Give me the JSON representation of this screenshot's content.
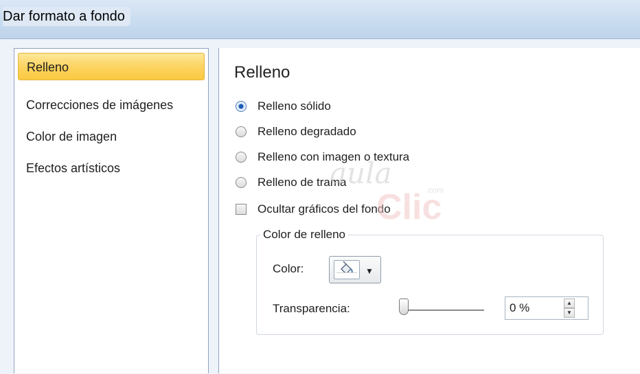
{
  "window": {
    "title": "Dar formato a fondo"
  },
  "sidebar": {
    "items": [
      {
        "label": "Relleno",
        "selected": true
      },
      {
        "label": "Correcciones de imágenes",
        "selected": false
      },
      {
        "label": "Color de imagen",
        "selected": false
      },
      {
        "label": "Efectos artísticos",
        "selected": false
      }
    ]
  },
  "main": {
    "heading": "Relleno",
    "fill_options": [
      {
        "label": "Relleno sólido",
        "checked": true
      },
      {
        "label": "Relleno degradado",
        "checked": false
      },
      {
        "label": "Relleno con imagen o textura",
        "checked": false
      },
      {
        "label": "Relleno de trama",
        "checked": false
      }
    ],
    "hide_graphics": {
      "label": "Ocultar gráficos del fondo",
      "checked": false
    },
    "fill_color_group": {
      "legend": "Color de relleno",
      "color_label": "Color:",
      "color_button_icon": "paint-bucket-icon",
      "transparency_label": "Transparencia:",
      "transparency_value": "0 %",
      "transparency_percent": 0
    }
  },
  "watermark": {
    "line1": "aula",
    "line2": "Clic",
    "suffix": ".com"
  },
  "colors": {
    "selected_nav": "#fcd461",
    "accent": "#1e5bb5",
    "title_bar": "#c9dcf0"
  }
}
